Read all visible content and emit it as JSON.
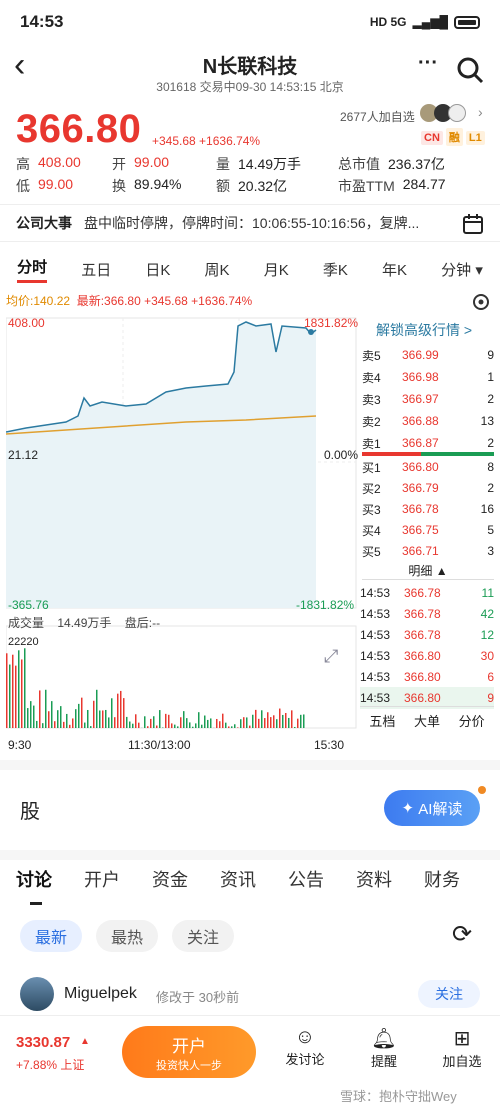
{
  "status": {
    "time": "14:53",
    "icons": "HD 5G"
  },
  "header": {
    "back": "‹",
    "title": "N长联科技",
    "subtitle": "301618 交易中09-30 14:53:15 北京",
    "more": "···"
  },
  "quote": {
    "price": "366.80",
    "change": "+345.68 +1636.74%",
    "followers": "2677人加自选",
    "tags": [
      "CN",
      "融",
      "L1"
    ],
    "stats": [
      {
        "k": "高",
        "v": "408.00",
        "c": "red"
      },
      {
        "k": "开",
        "v": "99.00",
        "c": "red"
      },
      {
        "k": "量",
        "v": "14.49万手",
        "c": "dark"
      },
      {
        "k": "总市值",
        "v": "236.37亿",
        "c": "dark"
      },
      {
        "k": "低",
        "v": "99.00",
        "c": "red"
      },
      {
        "k": "换",
        "v": "89.94%",
        "c": "dark"
      },
      {
        "k": "额",
        "v": "20.32亿",
        "c": "dark"
      },
      {
        "k": "市盈TTM",
        "v": "284.77",
        "c": "dark"
      }
    ]
  },
  "event": {
    "label": "公司大事",
    "text": "盘中临时停牌，停牌时间：10:06:55-10:16:56，复牌..."
  },
  "chart_tabs": [
    "分时",
    "五日",
    "日K",
    "周K",
    "月K",
    "季K",
    "年K",
    "分钟 ▾"
  ],
  "chart_info": {
    "avg": "均价:140.22",
    "latest": "最新:366.80",
    "chg": "+345.68",
    "pct": "+1636.74%"
  },
  "chart_labels": {
    "top_left": "408.00",
    "top_right": "1831.82%",
    "mid_left": "21.12",
    "mid_right": "0.00%",
    "bot_left": "-365.76",
    "bot_right": "-1831.82%",
    "vol_label": "成交量",
    "vol_value": "14.49万手",
    "after": "盘后:--",
    "vol_max": "22220",
    "t0": "9:30",
    "t1": "11:30/13:00",
    "t2": "15:30"
  },
  "chart_data": {
    "type": "line",
    "x": [
      "9:30",
      "11:30/13:00",
      "15:30"
    ],
    "series": [
      {
        "name": "最新",
        "values": [
          21.12,
          60,
          130,
          170,
          366.8
        ]
      },
      {
        "name": "均价",
        "values": [
          21.12,
          60,
          95,
          120,
          140.22
        ]
      }
    ],
    "ylim": [
      -365.76,
      408.0
    ]
  },
  "orderbook": {
    "unlock": "解锁高级行情 >",
    "asks": [
      [
        "卖5",
        "366.99",
        "9"
      ],
      [
        "卖4",
        "366.98",
        "1"
      ],
      [
        "卖3",
        "366.97",
        "2"
      ],
      [
        "卖2",
        "366.88",
        "13"
      ],
      [
        "卖1",
        "366.87",
        "2"
      ]
    ],
    "bids": [
      [
        "买1",
        "366.80",
        "8"
      ],
      [
        "买2",
        "366.79",
        "2"
      ],
      [
        "买3",
        "366.78",
        "16"
      ],
      [
        "买4",
        "366.75",
        "5"
      ],
      [
        "买5",
        "366.71",
        "3"
      ]
    ],
    "detail": "明细 ▲",
    "ticks": [
      [
        "14:53",
        "366.78",
        "11"
      ],
      [
        "14:53",
        "366.78",
        "42"
      ],
      [
        "14:53",
        "366.78",
        "12"
      ],
      [
        "14:53",
        "366.80",
        "30"
      ],
      [
        "14:53",
        "366.80",
        "6"
      ],
      [
        "14:53",
        "366.80",
        "9"
      ]
    ],
    "bottom_tabs": [
      "五档",
      "大单",
      "分价"
    ]
  },
  "section": {
    "stock": "股",
    "ai": "AI解读"
  },
  "discussion": {
    "tabs": [
      "讨论",
      "开户",
      "资金",
      "资讯",
      "公告",
      "资料",
      "财务"
    ],
    "filters": [
      "最新",
      "最热",
      "关注"
    ],
    "user": "Miguelpek",
    "time": "修改于 30秒前",
    "follow": "关注"
  },
  "footer": {
    "index": "3330.87",
    "index_chg": "+7.88% 上证",
    "open_title": "开户",
    "open_sub": "投资快人一步",
    "btn1": "发讨论",
    "btn2": "提醒",
    "btn3": "加自选",
    "watermark": "雪球：抱朴守拙Wey"
  }
}
